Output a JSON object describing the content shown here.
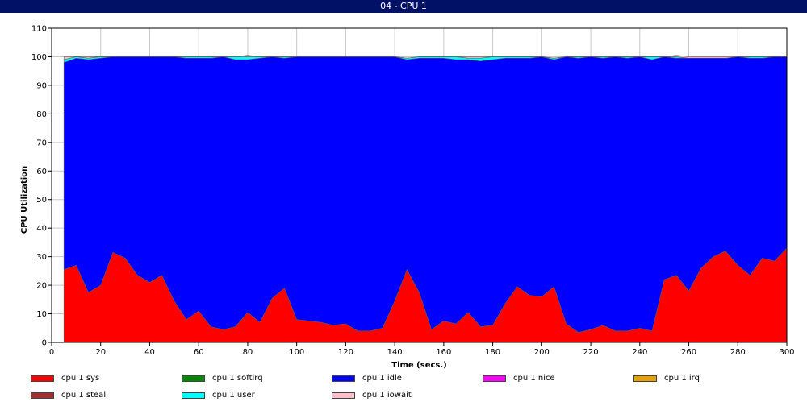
{
  "window": {
    "title": "04 - CPU 1"
  },
  "chart_data": {
    "type": "area",
    "stacked": true,
    "title": "",
    "xlabel": "Time (secs.)",
    "ylabel": "CPU Utilization",
    "xlim": [
      0,
      300
    ],
    "ylim": [
      0,
      110
    ],
    "x_ticks": [
      0,
      20,
      40,
      60,
      80,
      100,
      120,
      140,
      160,
      180,
      200,
      220,
      240,
      260,
      280,
      300
    ],
    "y_ticks": [
      0,
      10,
      20,
      30,
      40,
      50,
      60,
      70,
      80,
      90,
      100,
      110
    ],
    "grid": true,
    "legend_position": "bottom",
    "x": [
      5,
      10,
      15,
      20,
      25,
      30,
      35,
      40,
      45,
      50,
      55,
      60,
      65,
      70,
      75,
      80,
      85,
      90,
      95,
      100,
      105,
      110,
      115,
      120,
      125,
      130,
      135,
      140,
      145,
      150,
      155,
      160,
      165,
      170,
      175,
      180,
      185,
      190,
      195,
      200,
      205,
      210,
      215,
      220,
      225,
      230,
      235,
      240,
      245,
      250,
      255,
      260,
      265,
      270,
      275,
      280,
      285,
      290,
      295,
      300
    ],
    "series": [
      {
        "name": "cpu 1 sys",
        "color": "#ff0000",
        "values": [
          25.5,
          27,
          17.5,
          20,
          31.5,
          29.5,
          23.5,
          21,
          23.5,
          14.5,
          8,
          11,
          5.5,
          4.5,
          5.5,
          10.5,
          7,
          15.5,
          19,
          8,
          7.5,
          7,
          6,
          6.5,
          4,
          4,
          5,
          14.5,
          25.5,
          17.5,
          4.5,
          7.5,
          6.5,
          10.5,
          5.5,
          6,
          13.5,
          19.5,
          16.5,
          16,
          19.5,
          6.5,
          3.5,
          4.5,
          6,
          4,
          4,
          5,
          4,
          22,
          23.5,
          18,
          26,
          30,
          32,
          27,
          23.5,
          29.5,
          28.5,
          33
        ]
      },
      {
        "name": "cpu 1 softirq",
        "color": "#008800",
        "values": [
          0,
          0,
          0,
          0,
          0,
          0,
          0,
          0,
          0,
          0,
          0,
          0,
          0,
          0,
          0,
          0,
          0,
          0,
          0,
          0,
          0,
          0,
          0,
          0,
          0,
          0,
          0,
          0,
          0,
          0,
          0,
          0,
          0,
          0,
          0,
          0,
          0,
          0,
          0,
          0,
          0,
          0,
          0,
          0,
          0,
          0,
          0,
          0,
          0,
          0,
          0,
          0,
          0,
          0,
          0,
          0,
          0,
          0,
          0,
          0
        ]
      },
      {
        "name": "cpu 1 idle",
        "color": "#0000ff",
        "values": [
          72.5,
          72.5,
          81.5,
          79.5,
          68.5,
          70.5,
          76.5,
          79,
          76.5,
          85.5,
          91.5,
          88.5,
          94,
          95.5,
          93.5,
          88.5,
          92.5,
          84.5,
          80.5,
          92,
          92.5,
          93,
          94,
          93.5,
          96,
          96,
          95,
          85.5,
          73.5,
          82,
          95,
          92,
          92.5,
          88.5,
          93,
          93,
          86,
          80,
          83,
          84,
          79.5,
          93.5,
          96,
          95.5,
          93.5,
          96,
          95.5,
          95,
          95,
          78,
          76,
          81.5,
          73.5,
          69.5,
          67.5,
          73,
          76,
          70,
          71.5,
          67
        ]
      },
      {
        "name": "cpu 1 nice",
        "color": "#ff00ff",
        "values": [
          0,
          0,
          0,
          0,
          0,
          0,
          0,
          0,
          0,
          0,
          0,
          0,
          0,
          0,
          0,
          0,
          0,
          0,
          0,
          0,
          0,
          0,
          0,
          0,
          0,
          0,
          0,
          0,
          0,
          0,
          0,
          0,
          0,
          0,
          0,
          0,
          0,
          0,
          0,
          0,
          0,
          0,
          0,
          0,
          0,
          0,
          0,
          0,
          0,
          0,
          0,
          0,
          0,
          0,
          0,
          0,
          0,
          0,
          0,
          0
        ]
      },
      {
        "name": "cpu 1 irq",
        "color": "#e8a000",
        "values": [
          0,
          0,
          0,
          0,
          0,
          0,
          0,
          0,
          0,
          0,
          0,
          0,
          0,
          0,
          0,
          0,
          0,
          0,
          0,
          0,
          0,
          0,
          0,
          0,
          0,
          0,
          0,
          0,
          0,
          0,
          0,
          0,
          0,
          0,
          0,
          0,
          0,
          0,
          0,
          0,
          0,
          0,
          0,
          0,
          0,
          0,
          0,
          0,
          0,
          0,
          0,
          0,
          0,
          0,
          0,
          0,
          0,
          0,
          0,
          0
        ]
      },
      {
        "name": "cpu 1 steal",
        "color": "#a03030",
        "values": [
          0,
          0,
          0,
          0,
          0,
          0,
          0,
          0,
          0,
          0,
          0,
          0,
          0,
          0,
          0,
          0,
          0,
          0,
          0,
          0,
          0,
          0,
          0,
          0,
          0,
          0,
          0,
          0,
          0,
          0,
          0,
          0,
          0,
          0,
          0,
          0,
          0,
          0,
          0,
          0,
          0,
          0,
          0,
          0,
          0,
          0,
          0,
          0,
          0,
          0,
          0,
          0,
          0,
          0,
          0,
          0,
          0,
          0,
          0,
          0
        ]
      },
      {
        "name": "cpu 1 user",
        "color": "#00ffff",
        "values": [
          1,
          0.5,
          0.5,
          0.5,
          0,
          0,
          0,
          0,
          0,
          0,
          0.5,
          0.5,
          0.5,
          0,
          1,
          1,
          0.5,
          0,
          0.5,
          0,
          0,
          0,
          0,
          0,
          0,
          0,
          0,
          0,
          0.5,
          0.5,
          0.5,
          0.5,
          1,
          0.5,
          1,
          1,
          0.5,
          0.5,
          0.5,
          0,
          0.5,
          0,
          0.5,
          0,
          0.5,
          0,
          0.5,
          0,
          1,
          0,
          0.5,
          0,
          0,
          0,
          0,
          0,
          0.5,
          0.5,
          0,
          0
        ]
      },
      {
        "name": "cpu 1 iowait",
        "color": "#ffc0cb",
        "values": [
          1,
          0,
          0.5,
          0,
          0,
          0,
          0,
          0,
          0,
          0,
          0,
          0,
          0,
          0,
          0,
          0.5,
          0,
          0,
          0,
          0,
          0,
          0,
          0,
          0,
          0,
          0,
          0,
          0,
          0,
          0,
          0,
          0,
          0,
          0.5,
          0.5,
          0,
          0,
          0,
          0,
          0,
          0,
          0,
          0,
          0,
          0,
          0,
          0,
          0,
          0,
          0,
          0.5,
          0.5,
          0.5,
          0.5,
          0.5,
          0,
          0,
          0,
          0,
          0
        ]
      }
    ]
  }
}
